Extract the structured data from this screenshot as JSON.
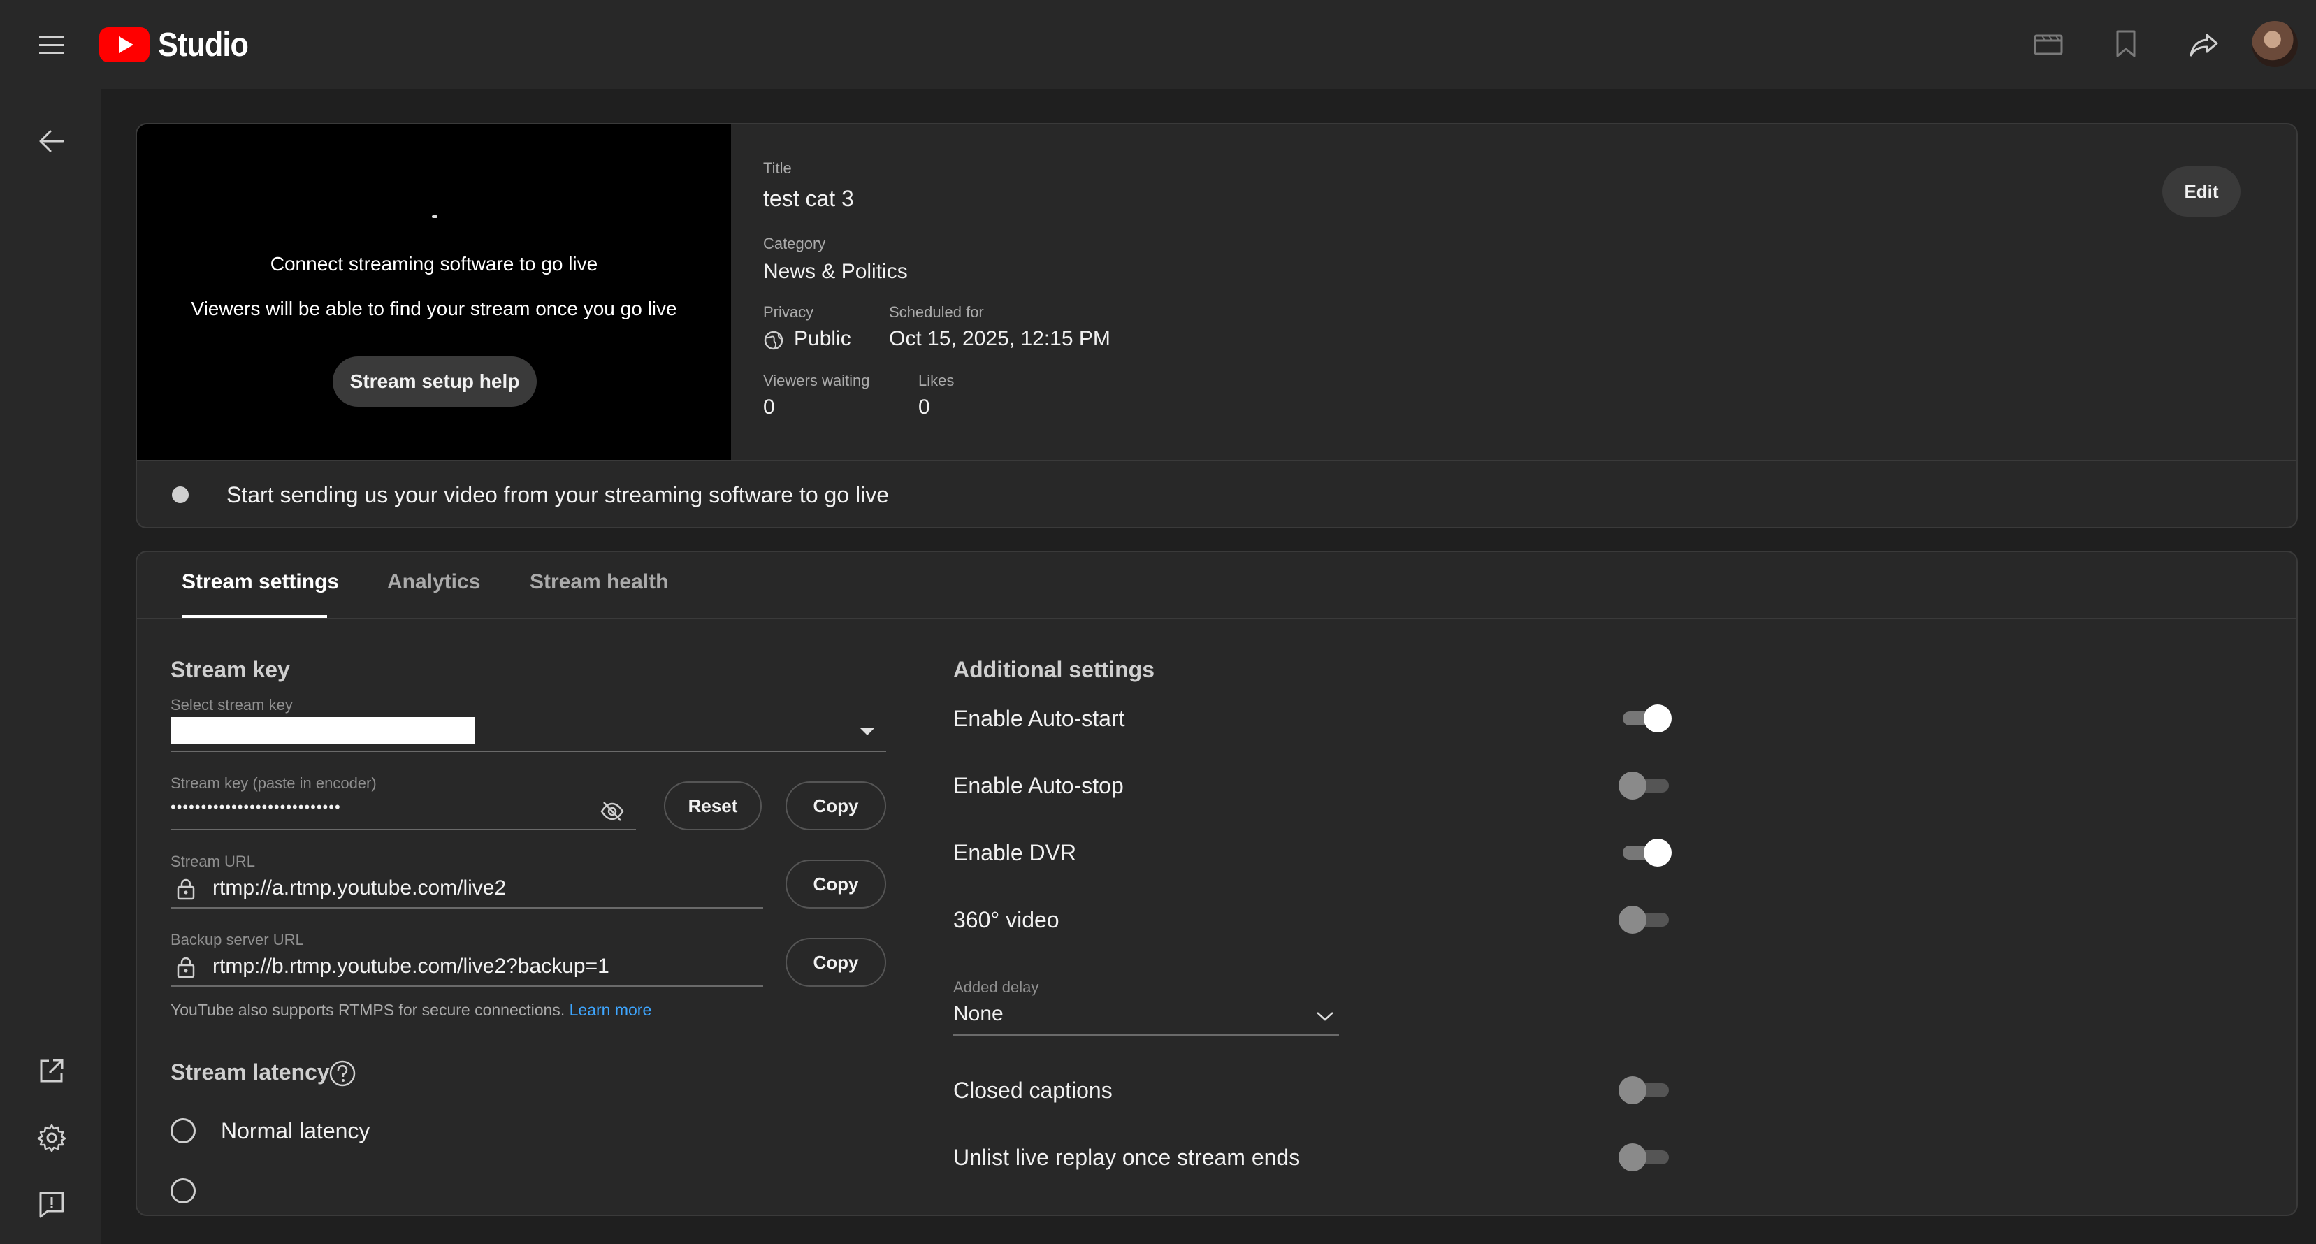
{
  "app": {
    "brand": "Studio",
    "brand_color": "#ff0000"
  },
  "topbar": {
    "menu_icon": "menu-icon",
    "icons": [
      "clapperboard-icon",
      "bookmark-icon",
      "share-icon"
    ]
  },
  "preview": {
    "message": "Connect streaming software to go live",
    "sub_message": "Viewers will be able to find your stream once you go live",
    "help_button": "Stream setup help"
  },
  "details": {
    "title_label": "Title",
    "title": "test cat 3",
    "category_label": "Category",
    "category": "News & Politics",
    "privacy_label": "Privacy",
    "privacy": "Public",
    "scheduled_label": "Scheduled for",
    "scheduled": "Oct 15, 2025, 12:15 PM",
    "viewers_label": "Viewers waiting",
    "viewers": "0",
    "likes_label": "Likes",
    "likes": "0",
    "edit_button": "Edit"
  },
  "status": {
    "text": "Start sending us your video from your streaming software to go live"
  },
  "tabs": [
    {
      "label": "Stream settings",
      "active": true
    },
    {
      "label": "Analytics",
      "active": false
    },
    {
      "label": "Stream health",
      "active": false
    }
  ],
  "stream_key": {
    "section_title": "Stream key",
    "select_label": "Select stream key",
    "key_label": "Stream key (paste in encoder)",
    "key_value": "••••••••••••••••••••••••••••",
    "reset_button": "Reset",
    "copy_button": "Copy",
    "url_label": "Stream URL",
    "url_value": "rtmp://a.rtmp.youtube.com/live2",
    "backup_label": "Backup server URL",
    "backup_value": "rtmp://b.rtmp.youtube.com/live2?backup=1",
    "helper_text": "YouTube also supports RTMPS for secure connections.",
    "learn_more": "Learn more"
  },
  "latency": {
    "section_title": "Stream latency",
    "options": [
      "Normal latency"
    ]
  },
  "additional": {
    "section_title": "Additional settings",
    "auto_start": {
      "label": "Enable Auto-start",
      "on": true
    },
    "auto_stop": {
      "label": "Enable Auto-stop",
      "on": false
    },
    "dvr": {
      "label": "Enable DVR",
      "on": true
    },
    "video_360": {
      "label": "360° video",
      "on": false
    },
    "delay_label": "Added delay",
    "delay_value": "None",
    "captions": {
      "label": "Closed captions",
      "on": false
    },
    "unlist": {
      "label": "Unlist live replay once stream ends",
      "on": false
    }
  },
  "leftnav": {
    "icons": [
      "back-arrow-icon",
      "external-link-icon",
      "gear-icon",
      "feedback-icon"
    ]
  }
}
